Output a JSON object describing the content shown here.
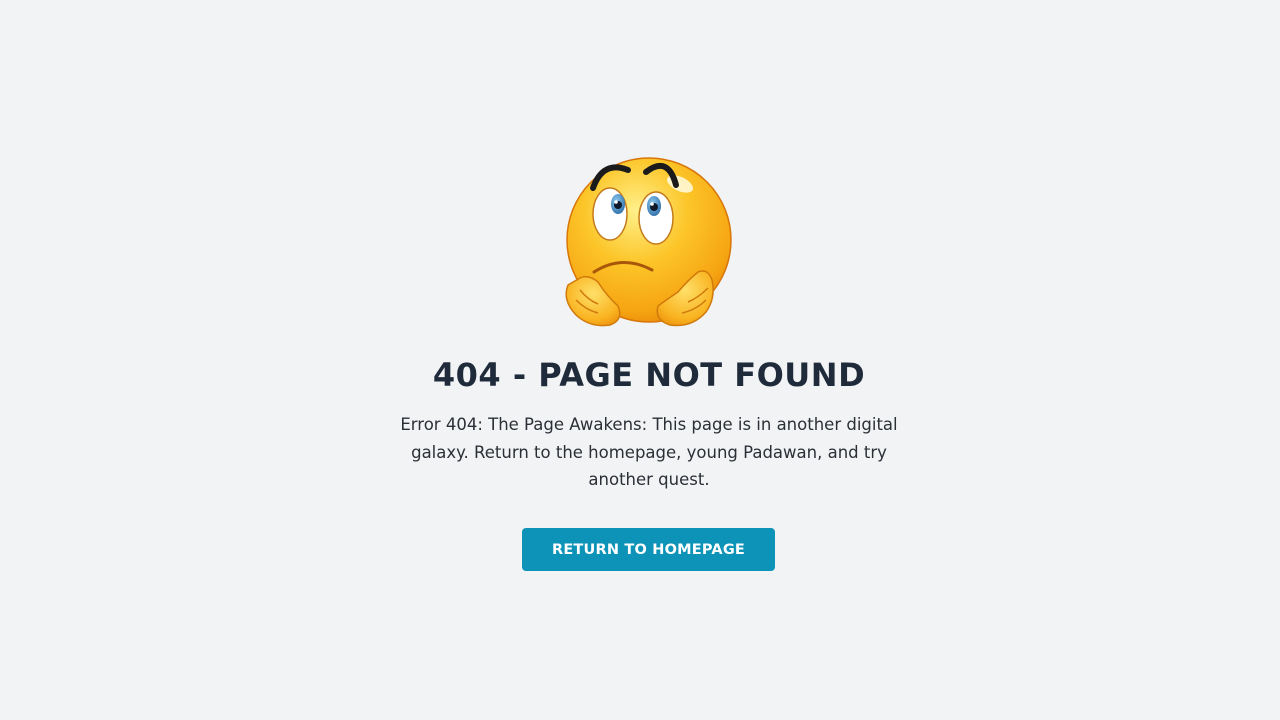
{
  "error": {
    "emoji_icon": "worried-face-emoji-icon",
    "title": "404 - PAGE NOT FOUND",
    "message": "Error 404: The Page Awakens: This page is in another digital galaxy. Return to the homepage, young Padawan, and try another quest.",
    "button_label": "RETURN TO HOMEPAGE"
  },
  "colors": {
    "background": "#f2f3f5",
    "title": "#1f2a3a",
    "text": "#2b2f36",
    "button": "#0c93b7",
    "button_text": "#ffffff",
    "emoji_face": "#fbb81a"
  }
}
